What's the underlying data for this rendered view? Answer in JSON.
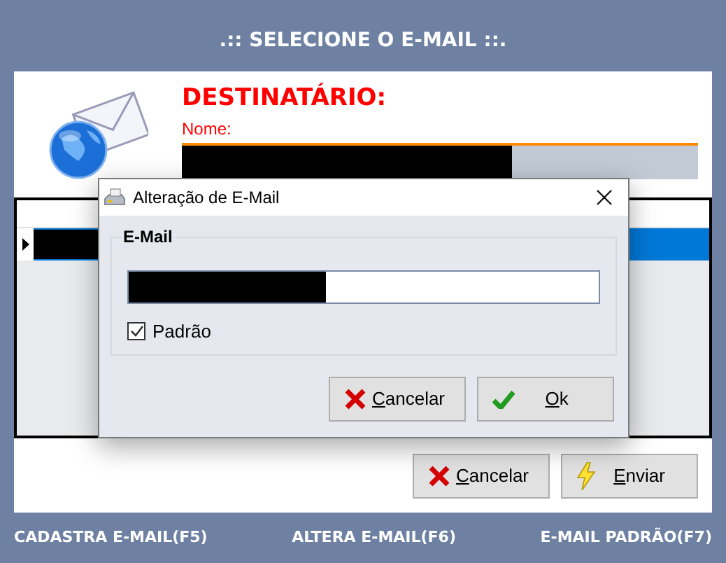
{
  "header": {
    "title": ".:: SELECIONE O E-MAIL ::."
  },
  "recipient": {
    "heading": "DESTINATÁRIO:",
    "name_label": "Nome:"
  },
  "grid": {
    "rows": [
      {
        "selected": true
      }
    ]
  },
  "dialog": {
    "title": "Alteração de E-Mail",
    "group_label": "E-Mail",
    "default_checkbox": {
      "label": "Padrão",
      "checked": true
    },
    "buttons": [
      {
        "label": "Cancelar",
        "kind": "cancel"
      },
      {
        "label": "Ok",
        "kind": "ok"
      }
    ]
  },
  "buttons": [
    {
      "label": "Cancelar",
      "kind": "cancel"
    },
    {
      "label": "Enviar",
      "kind": "send"
    }
  ],
  "shortcuts": [
    "CADASTRA E-MAIL(F5)",
    "ALTERA E-MAIL(F6)",
    "E-MAIL PADRÃO(F7)"
  ]
}
